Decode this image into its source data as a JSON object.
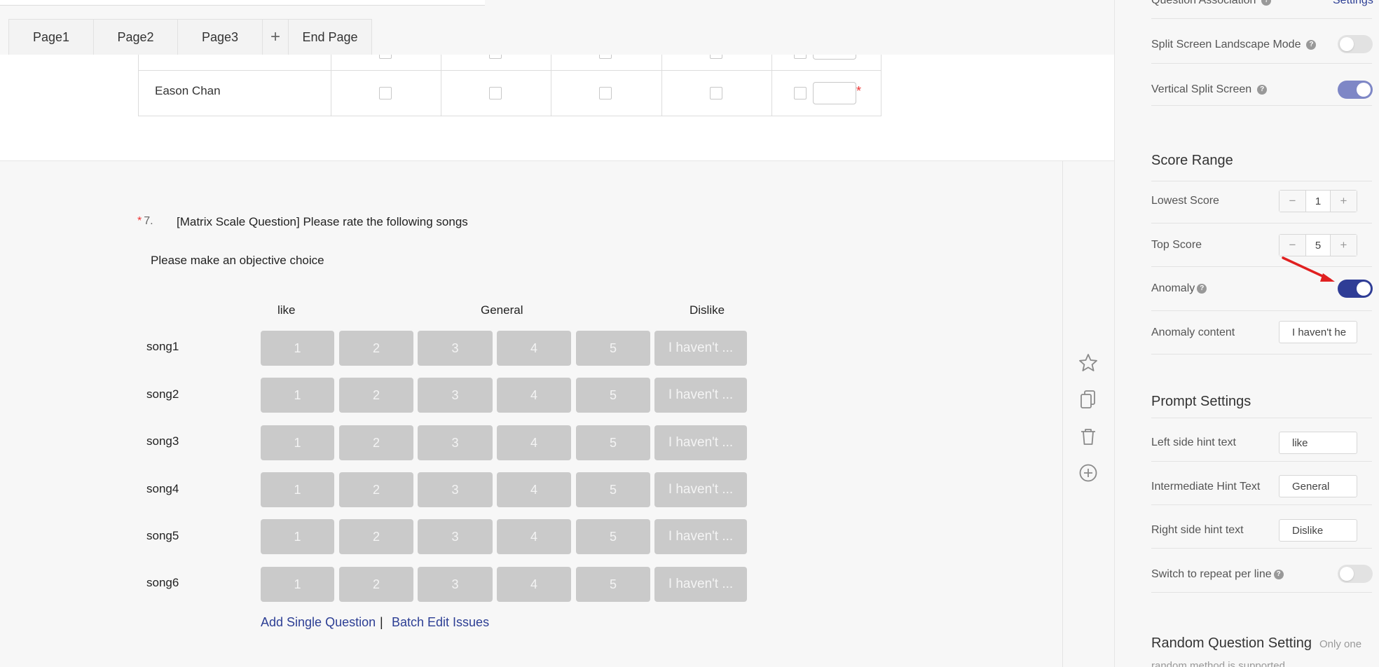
{
  "tabs": {
    "page1": "Page1",
    "page2": "Page2",
    "page3": "Page3",
    "add": "+",
    "end": "End Page"
  },
  "upper_table": {
    "row_name": "Eason Chan",
    "required_mark": "*"
  },
  "question": {
    "required_mark": "*",
    "number": "7.",
    "title": "[Matrix Scale Question] Please rate the following songs",
    "description": "Please make an objective choice",
    "hints": {
      "left": "like",
      "middle": "General",
      "right": "Dislike"
    },
    "rows": [
      "song1",
      "song2",
      "song3",
      "song4",
      "song5",
      "song6"
    ],
    "options": [
      "1",
      "2",
      "3",
      "4",
      "5",
      "I haven't ..."
    ],
    "add_single": "Add Single Question",
    "separator": "|",
    "batch_edit": "Batch Edit Issues"
  },
  "action_icons": [
    "star-icon",
    "copy-icon",
    "trash-icon",
    "add-circle-icon"
  ],
  "panel": {
    "question_association": "Question Association",
    "settings_link": "Settings",
    "split_landscape": {
      "label": "Split Screen Landscape Mode",
      "on": false
    },
    "vertical_split": {
      "label": "Vertical Split Screen",
      "on": true
    },
    "score_range_title": "Score Range",
    "lowest_score": {
      "label": "Lowest Score",
      "value": "1"
    },
    "top_score": {
      "label": "Top Score",
      "value": "5"
    },
    "anomaly": {
      "label": "Anomaly",
      "on": true
    },
    "anomaly_content": {
      "label": "Anomaly content",
      "value": "I haven't he"
    },
    "prompt_title": "Prompt Settings",
    "left_hint": {
      "label": "Left side hint text",
      "value": "like"
    },
    "middle_hint": {
      "label": "Intermediate Hint Text",
      "value": "General"
    },
    "right_hint": {
      "label": "Right side hint text",
      "value": "Dislike"
    },
    "repeat_per_line": {
      "label": "Switch to repeat per line",
      "on": false
    },
    "random_title": "Random Question Setting",
    "random_note": "Only one",
    "random_note2": "random method is supported",
    "stepper_minus": "−",
    "stepper_plus": "+"
  },
  "colors": {
    "accent": "#2c3e94",
    "toggle_on": "#7e87c6",
    "toggle_dark": "#2f3d96",
    "required": "#e33333",
    "arrow": "#e02020"
  }
}
